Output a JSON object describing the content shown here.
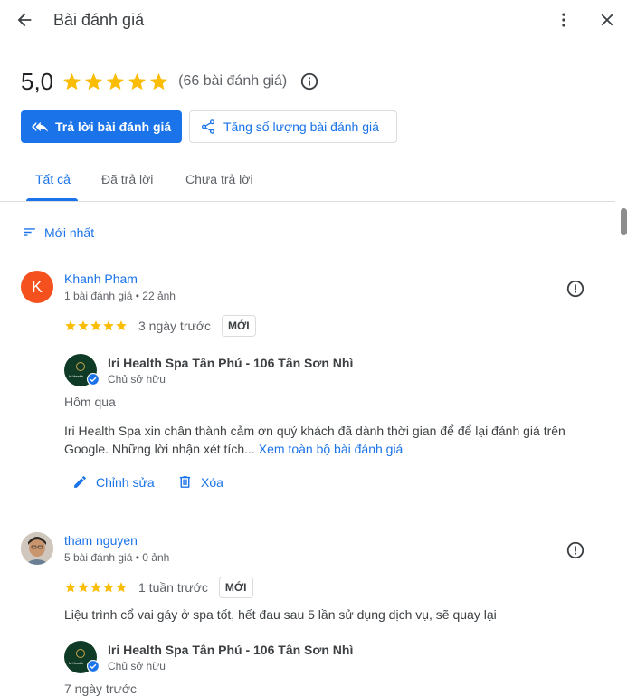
{
  "header": {
    "title": "Bài đánh giá"
  },
  "summary": {
    "rating": "5,0",
    "stars": 5,
    "count_text": "(66 bài đánh giá)"
  },
  "actions": {
    "reply_label": "Trả lời bài đánh giá",
    "boost_label": "Tăng số lượng bài đánh giá"
  },
  "tabs": [
    {
      "label": "Tất cả",
      "active": true
    },
    {
      "label": "Đã trả lời",
      "active": false
    },
    {
      "label": "Chưa trả lời",
      "active": false
    }
  ],
  "sort": {
    "label": "Mới nhất"
  },
  "reviews": [
    {
      "avatar_letter": "K",
      "name": "Khanh Pham",
      "meta": "1 bài đánh giá • 22 ảnh",
      "stars": 5,
      "date": "3 ngày trước",
      "badge": "MỚI",
      "reply": {
        "owner_name": "Iri Health Spa Tân Phú - 106 Tân Sơn Nhì",
        "owner_role": "Chủ sở hữu",
        "date": "Hôm qua",
        "text": "Iri Health Spa xin chân thành cảm ơn quý khách đã dành thời gian để để lại đánh giá trên Google. Những lời nhận xét tích...",
        "more_label": "Xem toàn bộ bài đánh giá",
        "edit_label": "Chỉnh sửa",
        "delete_label": "Xóa"
      }
    },
    {
      "name": "tham nguyen",
      "meta": "5 bài đánh giá • 0 ảnh",
      "stars": 5,
      "date": "1 tuần trước",
      "badge": "MỚI",
      "text": "Liệu trình cổ vai gáy ở spa tốt, hết đau sau 5 lần sử dụng dịch vụ, sẽ quay lại",
      "reply": {
        "owner_name": "Iri Health Spa Tân Phú - 106 Tân Sơn Nhì",
        "owner_role": "Chủ sở hữu",
        "date": "7 ngày trước"
      }
    }
  ],
  "colors": {
    "accent": "#1a73e8",
    "star": "#fbbc04",
    "avatar_k": "#f4511e",
    "owner_logo": "#0f3b26"
  },
  "icons": [
    "back-arrow-icon",
    "more-vert-icon",
    "close-icon",
    "star-icon",
    "info-icon",
    "reply-icon",
    "share-icon",
    "sort-icon",
    "flag-icon",
    "verified-icon",
    "edit-icon",
    "delete-icon"
  ]
}
